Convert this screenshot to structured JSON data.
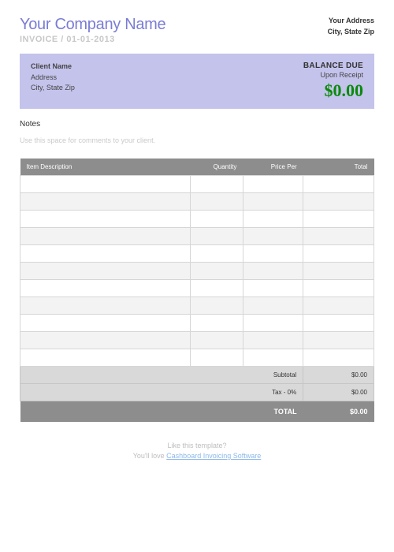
{
  "header": {
    "company_name": "Your Company Name",
    "invoice_label": "INVOICE",
    "invoice_date": "01-01-2013",
    "address_line1": "Your Address",
    "address_line2": "City, State Zip"
  },
  "client": {
    "name": "Client Name",
    "address": "Address",
    "city_state_zip": "City, State Zip",
    "balance_label": "BALANCE DUE",
    "balance_sub": "Upon Receipt",
    "balance_amount": "$0.00"
  },
  "notes": {
    "label": "Notes",
    "placeholder": "Use this space for comments to your client."
  },
  "table": {
    "headers": {
      "description": "Item Description",
      "quantity": "Quantity",
      "price_per": "Price Per",
      "total": "Total"
    },
    "subtotal_label": "Subtotal",
    "subtotal_value": "$0.00",
    "tax_label": "Tax - 0%",
    "tax_value": "$0.00",
    "total_label": "TOTAL",
    "total_value": "$0.00"
  },
  "footer": {
    "line1": "Like this template?",
    "line2_pre": "You'll love ",
    "link": "Cashboard Invoicing Software"
  }
}
